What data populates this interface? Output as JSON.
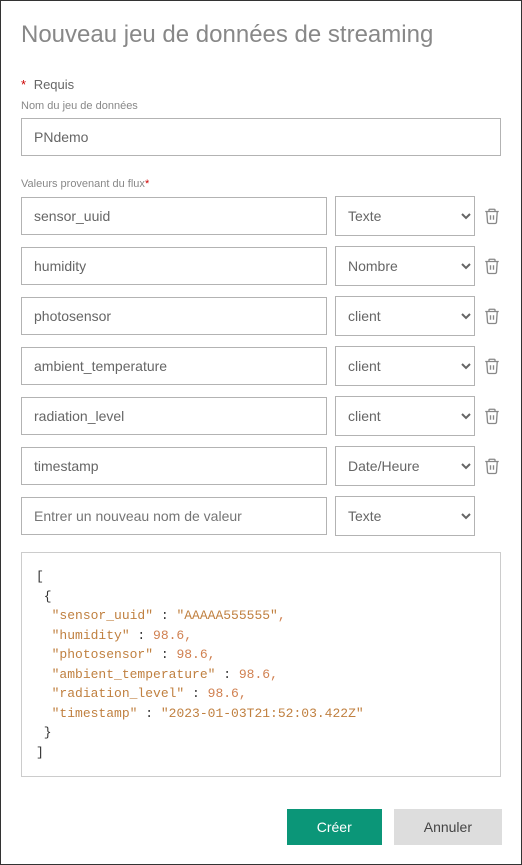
{
  "title": "Nouveau jeu de données de streaming",
  "required_label": "Requis",
  "name_label": "Nom du jeu de données",
  "name_value": "PNdemo",
  "values_label": "Valeurs provenant du flux",
  "type_options": [
    "Texte",
    "Nombre",
    "client",
    "Date/Heure"
  ],
  "values": [
    {
      "name": "sensor_uuid",
      "type": "Texte"
    },
    {
      "name": "humidity",
      "type": "Nombre"
    },
    {
      "name": "photosensor",
      "type": "client"
    },
    {
      "name": "ambient_temperature",
      "type": "client"
    },
    {
      "name": "radiation_level",
      "type": "client"
    },
    {
      "name": "timestamp",
      "type": "Date/Heure"
    }
  ],
  "new_value_placeholder": "Entrer un nouveau nom de valeur",
  "new_value_type": "Texte",
  "json_sample": {
    "sensor_uuid": "AAAAA555555",
    "humidity": 98.6,
    "photosensor": 98.6,
    "ambient_temperature": 98.6,
    "radiation_level": 98.6,
    "timestamp": "2023-01-03T21:52:03.422Z"
  },
  "footer": {
    "create": "Créer",
    "cancel": "Annuler"
  }
}
